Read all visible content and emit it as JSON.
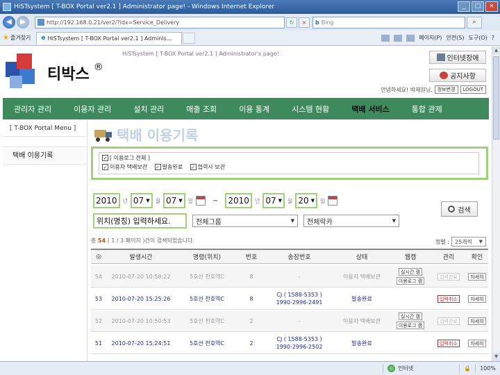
{
  "browser": {
    "title": "HiSTsystem [ T-BOX Portal ver2.1 ] Administrator page! - Windows Internet Explorer",
    "url": "http://192.168.0.21/ver2/?idx=Service_Delivery",
    "search_placeholder": "Bing",
    "favorites": "즐겨찾기",
    "tab_title": "HiSTsystem [ T-BOX Portal ver2.1 ] Adminis...",
    "cmd_page": "페이지(P)",
    "cmd_safety": "안전(S)",
    "cmd_tools": "도구(O)"
  },
  "header": {
    "brand": "티박스",
    "brand_mark": "®",
    "system_title": "HiSTsystem [ T-BOX Portal ver2.1 ] Administrator's page!",
    "intranet_button": "인터넷장애",
    "notice_button": "공지사항",
    "greeting": "안녕하세요! 박재원님.",
    "edit_info": "정보변경",
    "logout": "LOGOUT"
  },
  "nav": {
    "items": [
      "관리자 관리",
      "이용자 관리",
      "설치 관리",
      "매출 조회",
      "이용 통계",
      "시스템 현황",
      "택배 서비스",
      "통합 관제"
    ]
  },
  "left_menu": {
    "heading": "[ T-BOX Portal Menu ]",
    "item": "택배 이용기록"
  },
  "content": {
    "title": "택배 이용기록",
    "filter_all": "[ 이용로그 전체 ]",
    "filter_1": "이용자 택배보관",
    "filter_2": "발송완료",
    "filter_3": "협력사 보관",
    "date_from": {
      "year": "2010",
      "month": "07",
      "day": "07"
    },
    "date_to": {
      "year": "2010",
      "month": "07",
      "day": "20"
    },
    "lbl_year": "년",
    "lbl_month": "월",
    "lbl_day": "일",
    "tilde": "~",
    "location_placeholder": "위치(명칭) 입력하세요.",
    "group_select": "전체그룹",
    "locker_select": "전체락카",
    "search_button": "검색",
    "result_prefix": "총",
    "result_total": "54",
    "result_suffix": "( 1 / 3 페이지 )건이 검색되었습니다.",
    "sort_label": "정렬 :",
    "sort_value": "25개씩"
  },
  "table": {
    "headers": [
      "◎",
      "발생시간",
      "명령(위치)",
      "번호",
      "송장번호",
      "상태",
      "웹캠",
      "관리",
      "확인"
    ],
    "rows": [
      {
        "no": "54",
        "time": "2010-07-20 10:58:22",
        "loc": "5호선 천호역C",
        "num": "8",
        "invoice1": "-",
        "invoice2": "",
        "status": "이용자 택배보관",
        "cam1": "실시간 캠",
        "cam2": "이용로그 캠",
        "manage": "입력완료",
        "check": "자세히"
      },
      {
        "no": "53",
        "time": "2010-07-20 15:25:26",
        "loc": "5호선 천호역C",
        "num": "8",
        "invoice1": "CJ ( 1588-5353 )",
        "invoice2": "1990-2996-2491",
        "status": "발송완료",
        "cam1": "",
        "cam2": "",
        "manage": "입력취소",
        "check": "자세히"
      },
      {
        "no": "52",
        "time": "2010-07-20 10:50:53",
        "loc": "5호선 천호역C",
        "num": "2",
        "invoice1": "-",
        "invoice2": "",
        "status": "이용자 택배보관",
        "cam1": "실시간 캠",
        "cam2": "이용로그 캠",
        "manage": "입력완료",
        "check": "자세히"
      },
      {
        "no": "51",
        "time": "2010-07-20 15:24:51",
        "loc": "5호선 천호역C",
        "num": "2",
        "invoice1": "CJ ( 1588-5353 )",
        "invoice2": "1990-2996-2502",
        "status": "발송완료",
        "cam1": "",
        "cam2": "",
        "manage": "입력취소",
        "check": "자세히"
      }
    ]
  },
  "status": {
    "zone": "인터넷",
    "zoom": "100%"
  }
}
